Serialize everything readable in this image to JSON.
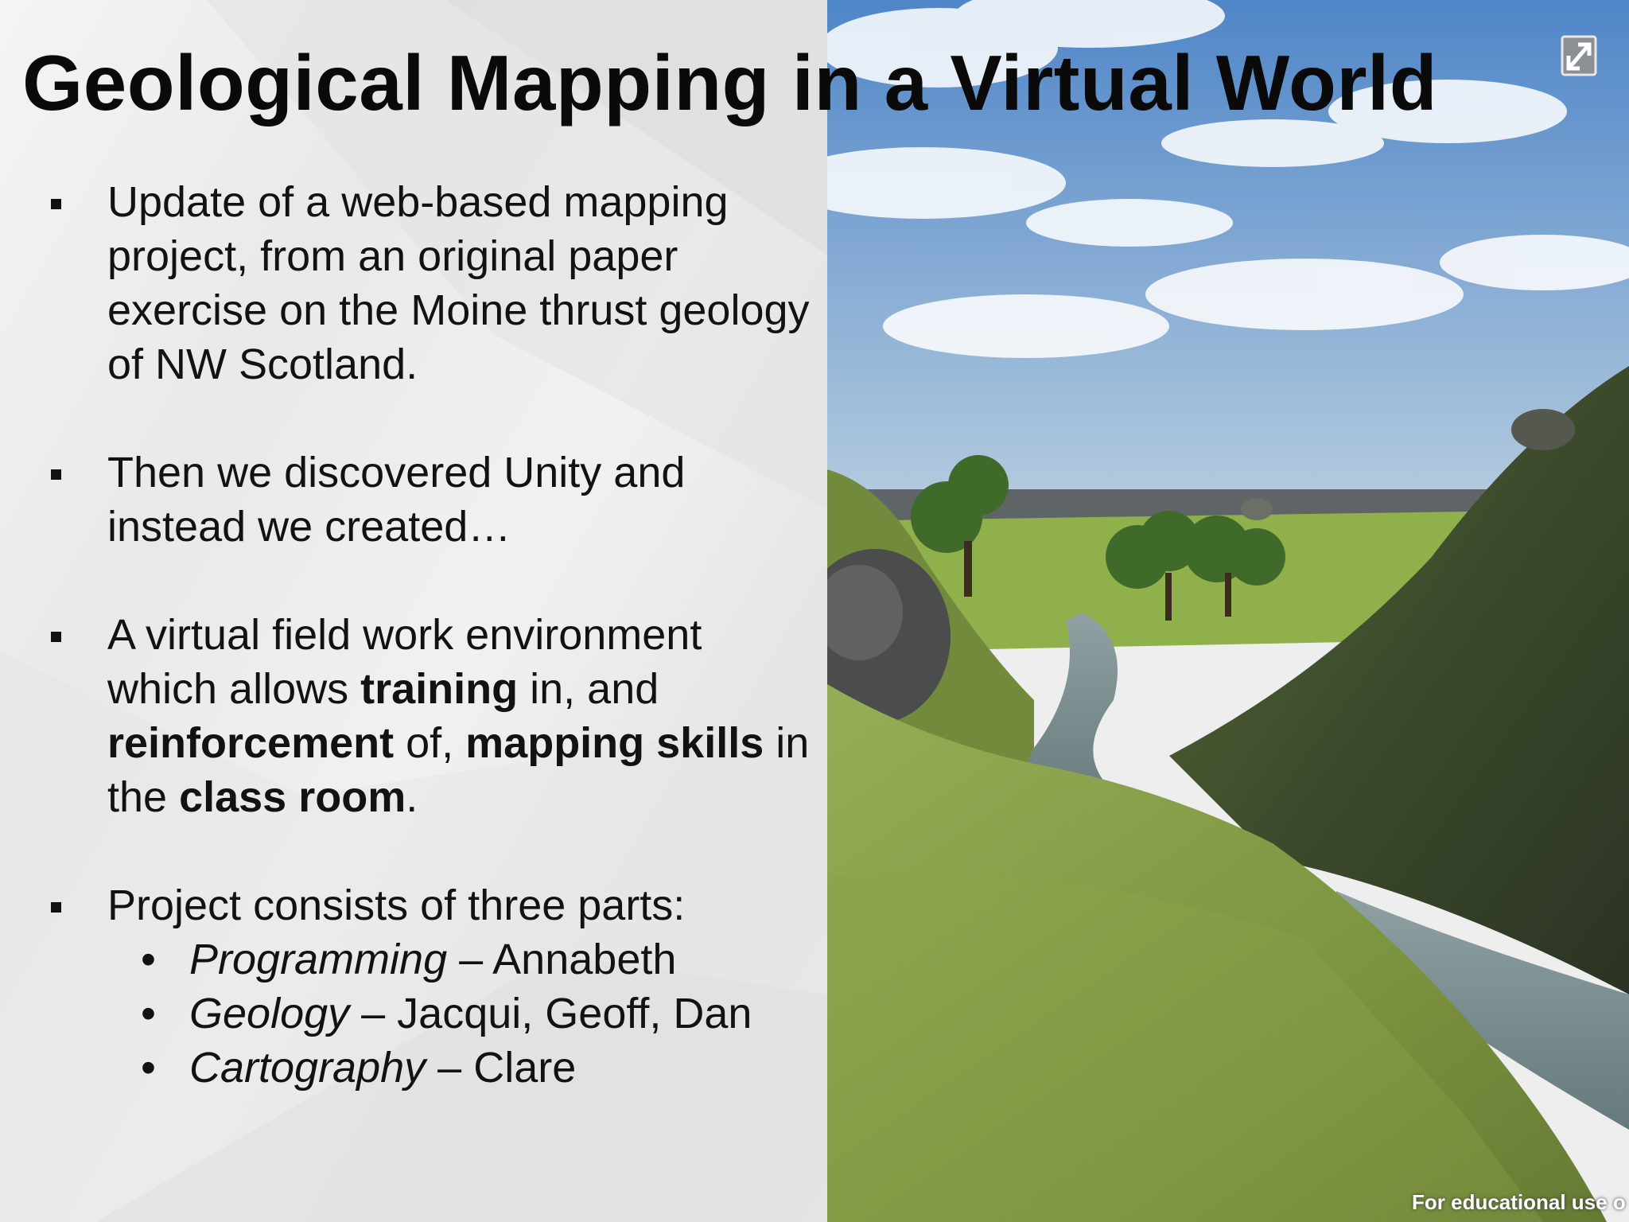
{
  "slide": {
    "title": "Geological Mapping in a Virtual World",
    "bullets": [
      {
        "parts": [
          {
            "text": "Update of a web-based mapping project, from an original paper exercise on the Moine thrust geology of NW Scotland."
          }
        ]
      },
      {
        "parts": [
          {
            "text": "Then we discovered Unity and instead we created…"
          }
        ]
      },
      {
        "parts": [
          {
            "text": "A virtual field work environment which allows "
          },
          {
            "text": "training",
            "bold": true
          },
          {
            "text": " in, and "
          },
          {
            "text": "reinforcement",
            "bold": true
          },
          {
            "text": " of, "
          },
          {
            "text": "mapping skills",
            "bold": true
          },
          {
            "text": " in the "
          },
          {
            "text": "class room",
            "bold": true
          },
          {
            "text": "."
          }
        ]
      },
      {
        "parts": [
          {
            "text": "Project consists of three parts:"
          }
        ],
        "subitems": [
          {
            "role": "Programming",
            "people": " – Annabeth"
          },
          {
            "role": "Geology",
            "people": " – Jacqui, Geoff, Dan"
          },
          {
            "role": "Cartography",
            "people": " – Clare"
          }
        ]
      }
    ],
    "sub_bullet_glyph": "•",
    "footer_note": "For educational use o",
    "expand_icon": "expand-diagonal-icon",
    "colors": {
      "sky": "#5b8fd0",
      "grass": "#8ea64a",
      "hill_dark": "#3c4a2c",
      "water": "#7f9292"
    }
  }
}
